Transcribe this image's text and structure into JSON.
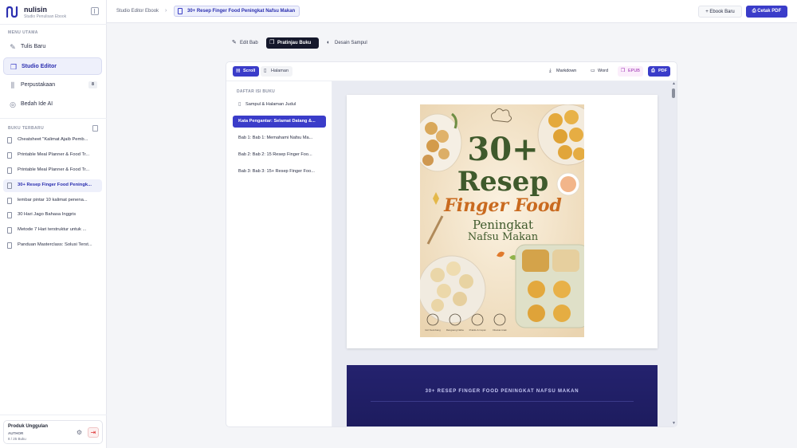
{
  "app": {
    "name": "nulisin",
    "tagline": "Studio Penulisan Ebook"
  },
  "sidebar": {
    "section_main": "MENU UTAMA",
    "nav": [
      {
        "label": "Tulis Baru",
        "icon": "pen-icon"
      },
      {
        "label": "Studio Editor",
        "icon": "book-open-icon"
      },
      {
        "label": "Perpustakaan",
        "icon": "library-icon",
        "badge": "8"
      },
      {
        "label": "Bedah Ide AI",
        "icon": "compass-icon"
      }
    ],
    "section_recent": "BUKU TERBARU",
    "recent_books": [
      "Cheatsheet \"Kalimat Ajaib Pemb...",
      "Printable Meal Planner & Food Tr...",
      "Printable Meal Planner & Food Tr...",
      "30+ Resep Finger Food Peningk...",
      "lembar pintar 10 kalimat penena...",
      "30 Hari Jago Bahasa Inggris",
      "Metode 7 Hari terstruktur untuk ...",
      "Panduan Masterclass: Solusi Terst..."
    ],
    "profile": {
      "name": "Produk Unggulan",
      "role": "AUTHOR",
      "count": "8 / 25 Buku"
    }
  },
  "topbar": {
    "breadcrumb_root": "Studio Editor Ebook",
    "breadcrumb_current": "30+ Resep Finger Food Peningkat Nafsu Makan",
    "new_ebook": "Ebook Baru",
    "print_pdf": "Cetak PDF"
  },
  "tabs": [
    {
      "label": "Edit Bab",
      "icon": "edit-icon"
    },
    {
      "label": "Pratinjau Buku",
      "icon": "book-open-icon"
    },
    {
      "label": "Desain Sampul",
      "icon": "palette-icon"
    }
  ],
  "preview": {
    "modes": [
      "Scroll",
      "Halaman"
    ],
    "exports": [
      "Markdown",
      "Word",
      "EPUB",
      "PDF"
    ],
    "toc_title": "DAFTAR ISI BUKU",
    "toc": [
      "Sampul & Halaman Judul",
      "Kata Pengantar: Selamat Datang &...",
      "Bab 1: Bab 1: Memahami Nafsu Ma...",
      "Bab 2: Bab 2: 15 Resep Finger Foo...",
      "Bab 3: Bab 3: 15+ Resep Finger Foo..."
    ],
    "cover": {
      "number": "30+",
      "line1": "Resep",
      "line2": "Finger Food",
      "line3": "Peningkat",
      "line4": "Nafsu Makan",
      "features": [
        "Gizi Seimbang",
        "Rangsang Nafsu",
        "Praktis & Cepat",
        "Disukai Anak"
      ]
    },
    "page2_title": "30+ RESEP FINGER FOOD PENINGKAT NAFSU MAKAN"
  },
  "colors": {
    "accent": "#3a3cc9",
    "dark": "#15182b",
    "cover_title": "#3f5a2c",
    "cover_script": "#c96a1f"
  }
}
